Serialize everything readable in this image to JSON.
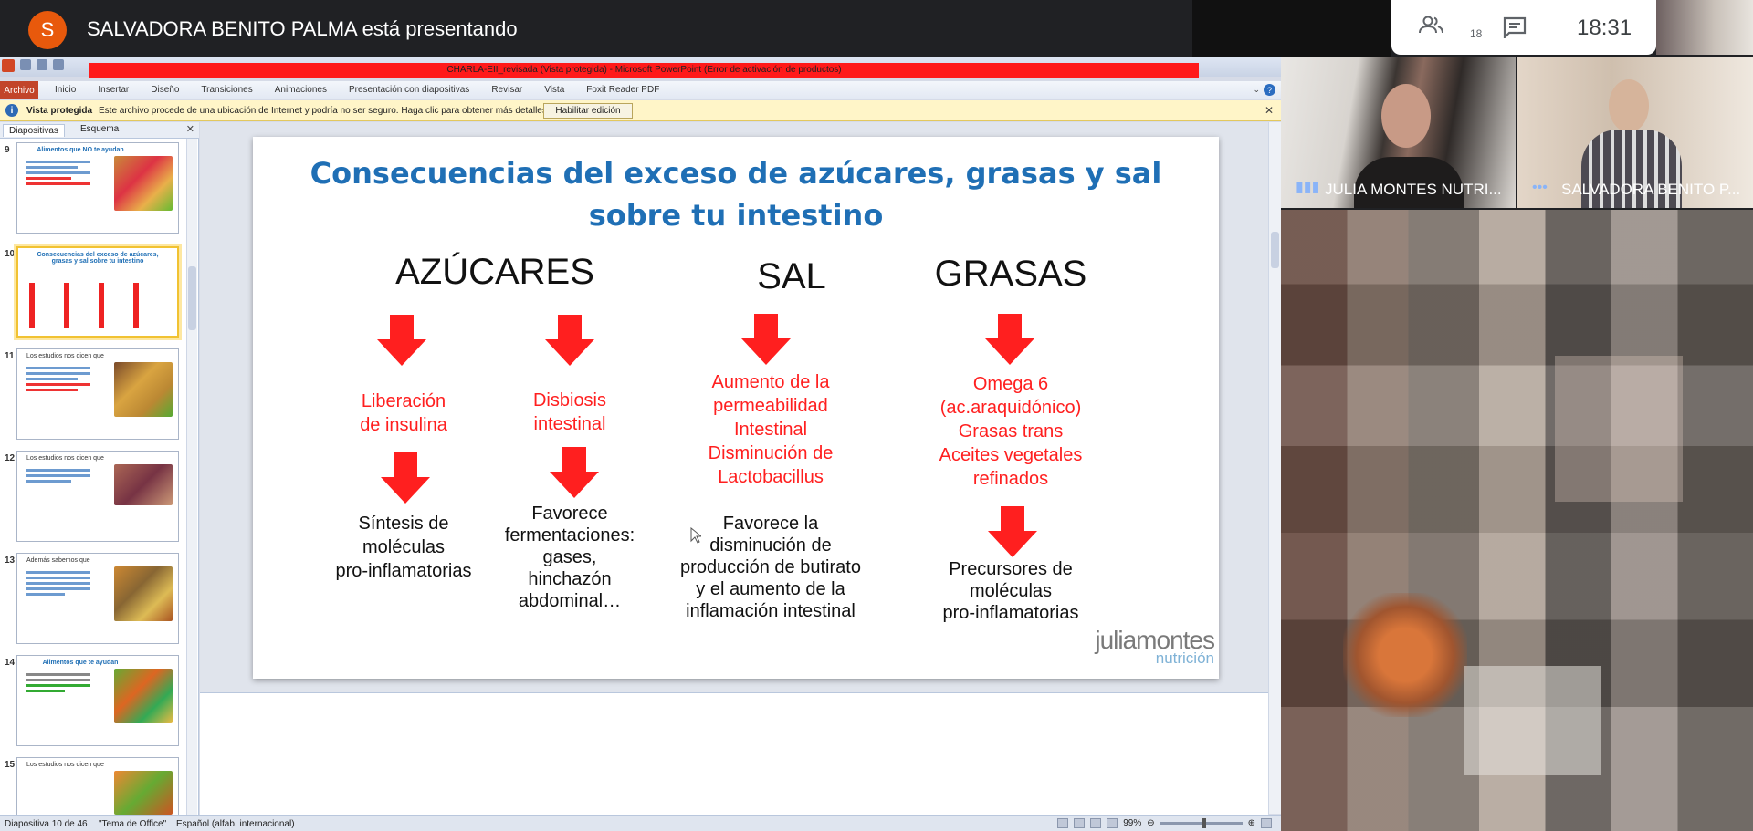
{
  "meet": {
    "presenter_initial": "S",
    "presenting_title": "SALVADORA BENITO PALMA está presentando",
    "participants_count": "18",
    "clock": "18:31",
    "tiles": [
      {
        "name": "JULIA MONTES NUTRI..."
      },
      {
        "name": "SALVADORA BENITO P..."
      }
    ]
  },
  "ppt": {
    "window_title": "CHARLA-EII_revisada (Vista protegida) - Microsoft PowerPoint (Error de activación de productos)",
    "file_tab": "Archivo",
    "tabs": [
      "Inicio",
      "Insertar",
      "Diseño",
      "Transiciones",
      "Animaciones",
      "Presentación con diapositivas",
      "Revisar",
      "Vista",
      "Foxit Reader PDF"
    ],
    "protected": {
      "label": "Vista protegida",
      "message": "Este archivo procede de una ubicación de Internet y podría no ser seguro. Haga clic para obtener más detalles.",
      "enable_button": "Habilitar edición"
    },
    "panel_tabs": {
      "slides": "Diapositivas",
      "outline": "Esquema"
    },
    "thumbnails": [
      {
        "num": "9",
        "title": "Alimentos que NO te ayudan"
      },
      {
        "num": "10",
        "title": "Consecuencias del exceso de azúcares, grasas y sal sobre tu intestino"
      },
      {
        "num": "11",
        "title": "Los estudios nos dicen que"
      },
      {
        "num": "12",
        "title": "Los estudios nos dicen que"
      },
      {
        "num": "13",
        "title": "Además sabemos que"
      },
      {
        "num": "14",
        "title": "Alimentos que te ayudan"
      },
      {
        "num": "15",
        "title": "Los estudios nos dicen que"
      }
    ],
    "status": {
      "slide_info": "Diapositiva 10 de 46",
      "theme": "\"Tema de Office\"",
      "language": "Español (alfab. internacional)",
      "zoom": "99%"
    }
  },
  "slide": {
    "title_line1": "Consecuencias del exceso de azúcares, grasas y sal",
    "title_line2": "sobre tu intestino",
    "heading_azucares": "AZÚCARES",
    "heading_sal": "SAL",
    "heading_grasas": "GRASAS",
    "col1_red": [
      "Liberación",
      "de insulina"
    ],
    "col1_black": [
      "Síntesis de",
      "moléculas",
      "pro-inflamatorias"
    ],
    "col2_red": [
      "Disbiosis",
      "intestinal"
    ],
    "col2_black": [
      "Favorece",
      "fermentaciones:",
      "gases,",
      "hinchazón",
      "abdominal…"
    ],
    "col3_red": [
      "Aumento de la",
      "permeabilidad",
      "Intestinal",
      "Disminución de",
      "Lactobacillus"
    ],
    "col3_black": [
      "Favorece la",
      "disminución de",
      "producción de butirato",
      "y el aumento de la",
      "inflamación intestinal"
    ],
    "col4_red": [
      "Omega 6",
      "(ac.araquidónico)",
      "Grasas trans",
      "Aceites vegetales",
      "refinados"
    ],
    "col4_black": [
      "Precursores de",
      "moléculas",
      "pro-inflamatorias"
    ],
    "logo_main": "juliamontes",
    "logo_sub": "nutrición"
  },
  "colors": {
    "slide_title": "#1f6fb5",
    "arrow_red": "#ff1f1f",
    "presenter_avatar": "#e8590c"
  }
}
